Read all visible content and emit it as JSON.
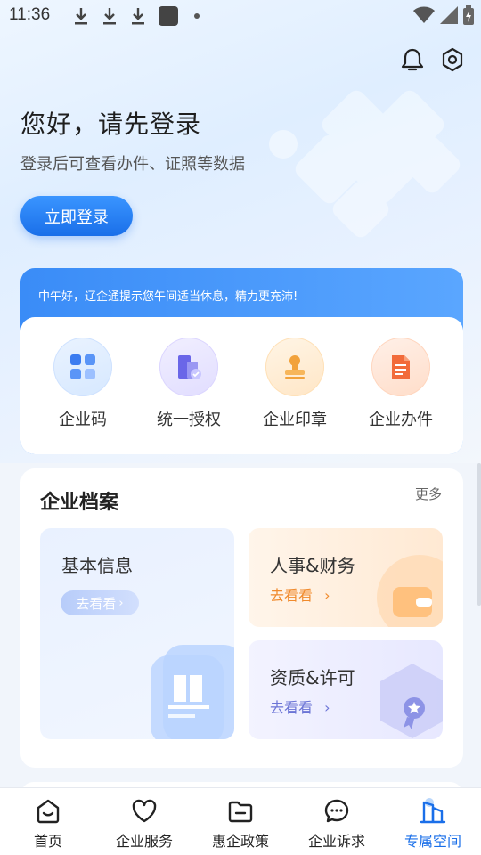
{
  "status_bar": {
    "time": "11:36",
    "icons": [
      "download-icon",
      "download-icon",
      "download-icon",
      "app-square-icon",
      "dot-icon",
      "wifi-icon",
      "signal-icon",
      "battery-charging-icon"
    ]
  },
  "header": {
    "icons": [
      "bell-icon",
      "settings-icon"
    ]
  },
  "greeting": {
    "title": "您好，请先登录",
    "subtitle": "登录后可查看办件、证照等数据",
    "login_label": "立即登录"
  },
  "tip": {
    "text": "中午好，辽企通提示您午间适当休息，精力更充沛!"
  },
  "quick_actions": [
    {
      "label": "企业码",
      "icon": "enterprise-code-icon"
    },
    {
      "label": "统一授权",
      "icon": "authorization-icon"
    },
    {
      "label": "企业印章",
      "icon": "seal-icon"
    },
    {
      "label": "企业办件",
      "icon": "document-icon"
    }
  ],
  "archive": {
    "title": "企业档案",
    "more_label": "更多",
    "tiles": [
      {
        "title": "基本信息",
        "link": "去看看",
        "icon": "building-icon"
      },
      {
        "title": "人事&财务",
        "link": "去看看",
        "icon": "wallet-icon"
      },
      {
        "title": "资质&许可",
        "link": "去看看",
        "icon": "certificate-icon"
      }
    ]
  },
  "bottom_nav": [
    {
      "label": "首页",
      "icon": "home-icon"
    },
    {
      "label": "企业服务",
      "icon": "heart-icon"
    },
    {
      "label": "惠企政策",
      "icon": "folder-icon"
    },
    {
      "label": "企业诉求",
      "icon": "chat-icon"
    },
    {
      "label": "专属空间",
      "icon": "buildings-icon",
      "active": true
    }
  ],
  "colors": {
    "accent": "#1a6fe9",
    "tip_bg": "#3a8cf7",
    "hr_link": "#f08a2c",
    "qual_link": "#6b74d6",
    "basic_link": "#ffffff"
  }
}
